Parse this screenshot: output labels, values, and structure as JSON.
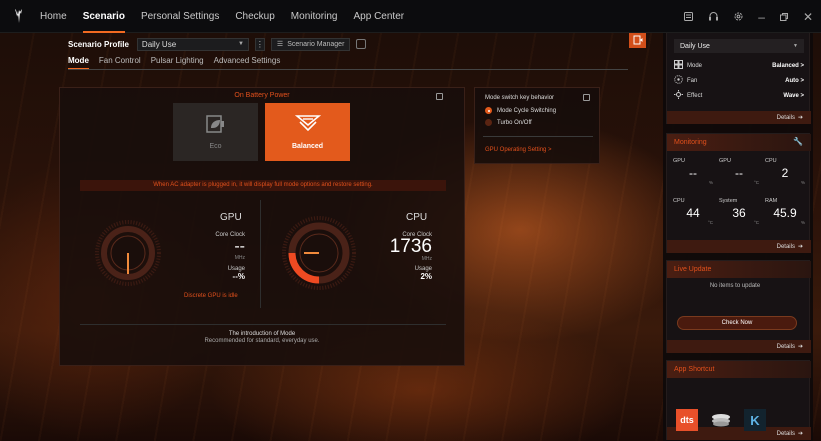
{
  "nav": {
    "items": [
      "Home",
      "Scenario",
      "Personal Settings",
      "Checkup",
      "Monitoring",
      "App Center"
    ],
    "active": "Scenario"
  },
  "scenario": {
    "profile_label": "Scenario Profile",
    "profile_value": "Daily Use",
    "manager_label": "Scenario Manager"
  },
  "tabs": [
    "Mode",
    "Fan Control",
    "Pulsar Lighting",
    "Advanced Settings"
  ],
  "mode_panel": {
    "battery_title": "On Battery Power",
    "modes": [
      {
        "label": "Eco",
        "state": "inactive"
      },
      {
        "label": "Balanced",
        "state": "active"
      }
    ],
    "ac_notice": "When AC adapter is plugged in, it will display full mode options and restore setting.",
    "gpu": {
      "title": "GPU",
      "core_clock_label": "Core Clock",
      "core_clock_value": "--",
      "core_clock_unit": "MHz",
      "usage_label": "Usage",
      "usage_value": "--%",
      "note": "Discrete GPU is idle",
      "gauge_fill": 0
    },
    "cpu": {
      "title": "CPU",
      "core_clock_label": "Core Clock",
      "core_clock_value": "1736",
      "core_clock_unit": "MHz",
      "usage_label": "Usage",
      "usage_value": "2%",
      "gauge_fill": 0.3
    },
    "intro_title": "The introduction of Mode",
    "intro_text": "Recommended for standard, everyday use."
  },
  "switch_panel": {
    "header": "Mode switch key behavior",
    "options": [
      "Mode Cycle Switching",
      "Turbo On/Off"
    ],
    "selected": "Mode Cycle Switching",
    "gpu_link": "GPU Operating Setting >"
  },
  "right": {
    "profile_dropdown": "Daily Use",
    "quick": [
      {
        "label": "Mode",
        "value": "Balanced >"
      },
      {
        "label": "Fan",
        "value": "Auto >"
      },
      {
        "label": "Effect",
        "value": "Wave >"
      }
    ],
    "details": "Details",
    "monitoring": {
      "title": "Monitoring",
      "cells": [
        {
          "label": "GPU",
          "value": "--",
          "unit": "%"
        },
        {
          "label": "GPU",
          "value": "--",
          "unit": "°C"
        },
        {
          "label": "CPU",
          "value": "2",
          "unit": "%"
        },
        {
          "label": "CPU",
          "value": "44",
          "unit": "°C"
        },
        {
          "label": "System",
          "value": "36",
          "unit": "°C"
        },
        {
          "label": "RAM",
          "value": "45.9",
          "unit": "%"
        }
      ]
    },
    "live_update": {
      "title": "Live Update",
      "empty_text": "No items to update",
      "button": "Check Now"
    },
    "app_shortcut": {
      "title": "App Shortcut",
      "apps": [
        "dts",
        "K"
      ]
    }
  },
  "colors": {
    "accent": "#f26a21",
    "accent_dark": "#e35a1c",
    "panel": "#181210"
  }
}
